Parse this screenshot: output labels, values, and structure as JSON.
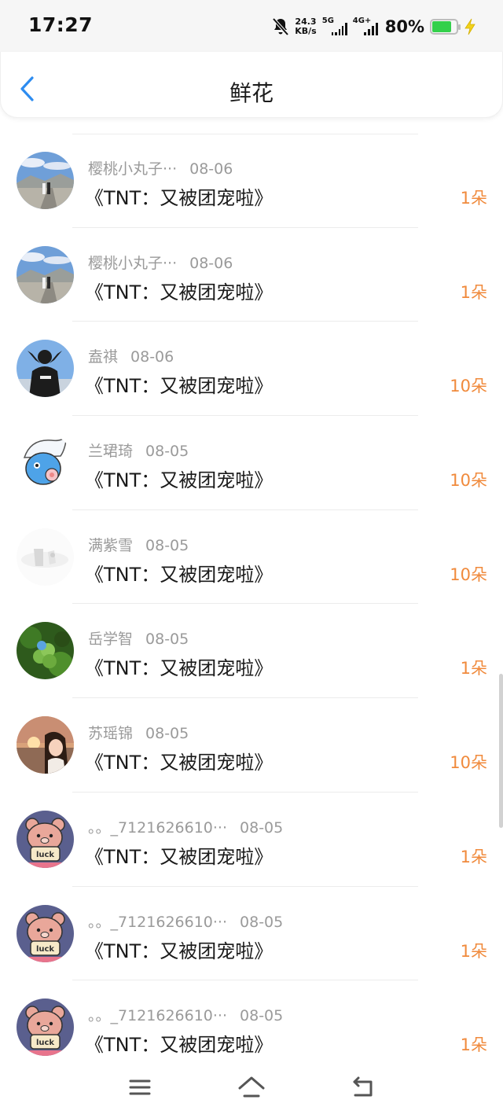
{
  "status_bar": {
    "time": "17:27",
    "net_speed_value": "24.3",
    "net_speed_unit": "KB/s",
    "signal_1_label": "5G",
    "signal_2_label": "4G+",
    "battery_percent": "80%",
    "battery_level": 0.8,
    "battery_color": "#33d04b"
  },
  "header": {
    "title": "鲜花",
    "back_icon": "chevron-left-icon",
    "accent_color": "#2d8cf0"
  },
  "items": [
    {
      "user": "樱桃小丸子···",
      "date": "08-06",
      "book": "《TNT：又被团宠啦》",
      "amount": "1朵"
    },
    {
      "user": "樱桃小丸子···",
      "date": "08-06",
      "book": "《TNT：又被团宠啦》",
      "amount": "1朵"
    },
    {
      "user": "盍祺",
      "date": "08-06",
      "book": "《TNT：又被团宠啦》",
      "amount": "10朵"
    },
    {
      "user": "兰珺琦",
      "date": "08-05",
      "book": "《TNT：又被团宠啦》",
      "amount": "10朵"
    },
    {
      "user": "满紫雪",
      "date": "08-05",
      "book": "《TNT：又被团宠啦》",
      "amount": "10朵"
    },
    {
      "user": "岳学智",
      "date": "08-05",
      "book": "《TNT：又被团宠啦》",
      "amount": "1朵"
    },
    {
      "user": "苏瑶锦",
      "date": "08-05",
      "book": "《TNT：又被团宠啦》",
      "amount": "10朵"
    },
    {
      "user": "。。_7121626610···",
      "date": "08-05",
      "book": "《TNT：又被团宠啦》",
      "amount": "1朵"
    },
    {
      "user": "。。_7121626610···",
      "date": "08-05",
      "book": "《TNT：又被团宠啦》",
      "amount": "1朵"
    },
    {
      "user": "。。_7121626610···",
      "date": "08-05",
      "book": "《TNT：又被团宠啦》",
      "amount": "1朵"
    }
  ],
  "amount_color": "#f08a3c",
  "system_nav": {
    "menu_icon": "menu-icon",
    "home_icon": "home-icon",
    "back_icon": "back-icon"
  }
}
